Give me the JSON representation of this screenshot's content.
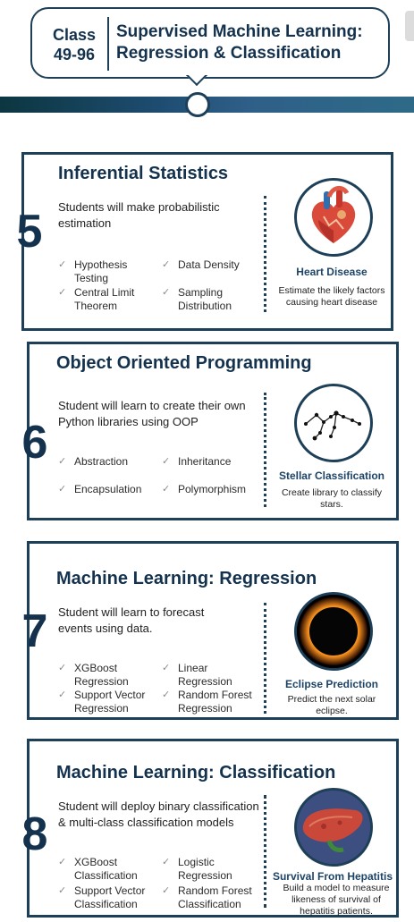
{
  "header": {
    "class_label": "Class\n49-96",
    "title": "Supervised Machine Learning:\nRegression & Classification"
  },
  "modules": [
    {
      "number": "5",
      "title": "Inferential Statistics",
      "description": "Students will make probabilistic estimation",
      "topics": [
        "Hypothesis\nTesting",
        "Data Density",
        "Central Limit\nTheorem",
        "Sampling\nDistribution"
      ],
      "project": {
        "name": "Heart Disease",
        "description": "Estimate the likely factors causing heart disease",
        "icon": "heart-icon"
      }
    },
    {
      "number": "6",
      "title": "Object Oriented Programming",
      "description": "Student will learn to create their own Python libraries using OOP",
      "topics": [
        "Abstraction",
        "Inheritance",
        "Encapsulation",
        "Polymorphism"
      ],
      "project": {
        "name": "Stellar Classification",
        "description": "Create library to classify stars.",
        "icon": "constellation-icon"
      }
    },
    {
      "number": "7",
      "title": "Machine Learning: Regression",
      "description": "Student will learn to forecast events using data.",
      "topics": [
        "XGBoost\nRegression",
        "Linear Regression",
        "Support Vector\nRegression",
        "Random Forest\nRegression"
      ],
      "project": {
        "name": "Eclipse Prediction",
        "description": "Predict the next solar eclipse.",
        "icon": "eclipse-icon"
      }
    },
    {
      "number": "8",
      "title": "Machine Learning: Classification",
      "description": "Student will deploy binary classification & multi-class classification models",
      "topics": [
        "XGBoost\nClassification",
        "Logistic\nRegression",
        "Support Vector\nClassification",
        "Random Forest\nClassification"
      ],
      "project": {
        "name": "Survival From Hepatitis",
        "description": "Build a model to measure likeness of survival of hepatitis patients.",
        "icon": "liver-icon"
      }
    }
  ]
}
